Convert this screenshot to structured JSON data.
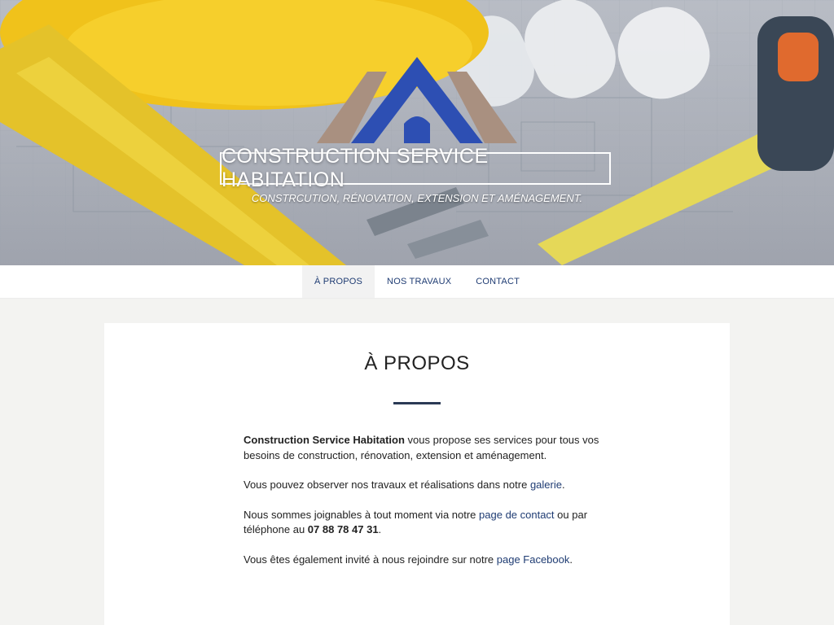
{
  "header": {
    "site_title": "CONSTRUCTION SERVICE HABITATION",
    "tagline": "CONSTRCUTION, RÉNOVATION, EXTENSION ET AMÉNAGEMENT."
  },
  "nav": {
    "items": [
      {
        "label": "À PROPOS",
        "active": true
      },
      {
        "label": "NOS TRAVAUX",
        "active": false
      },
      {
        "label": "CONTACT",
        "active": false
      }
    ]
  },
  "main": {
    "title": "À PROPOS",
    "p1_strong": "Construction Service Habitation",
    "p1_rest": " vous propose ses services pour tous vos besoins de construction, rénovation, extension et aménagement.",
    "p2_pre": "Vous pouvez observer nos travaux et réalisations dans notre ",
    "p2_link": "galerie",
    "p2_post": ".",
    "p3_pre": "Nous sommes joignables à tout moment via notre ",
    "p3_link": "page de contact",
    "p3_mid": " ou par téléphone au ",
    "p3_phone": "07 88 78 47 31",
    "p3_post": ".",
    "p4_pre": "Vous êtes également invité à nous rejoindre sur notre ",
    "p4_link": "page Facebook",
    "p4_post": "."
  },
  "colors": {
    "accent": "#1f3c73",
    "divider": "#2b3a55",
    "logo_blue": "#2d4fb3",
    "logo_taupe": "#a99080"
  },
  "icons": {
    "logo": "house-roof-logo"
  }
}
